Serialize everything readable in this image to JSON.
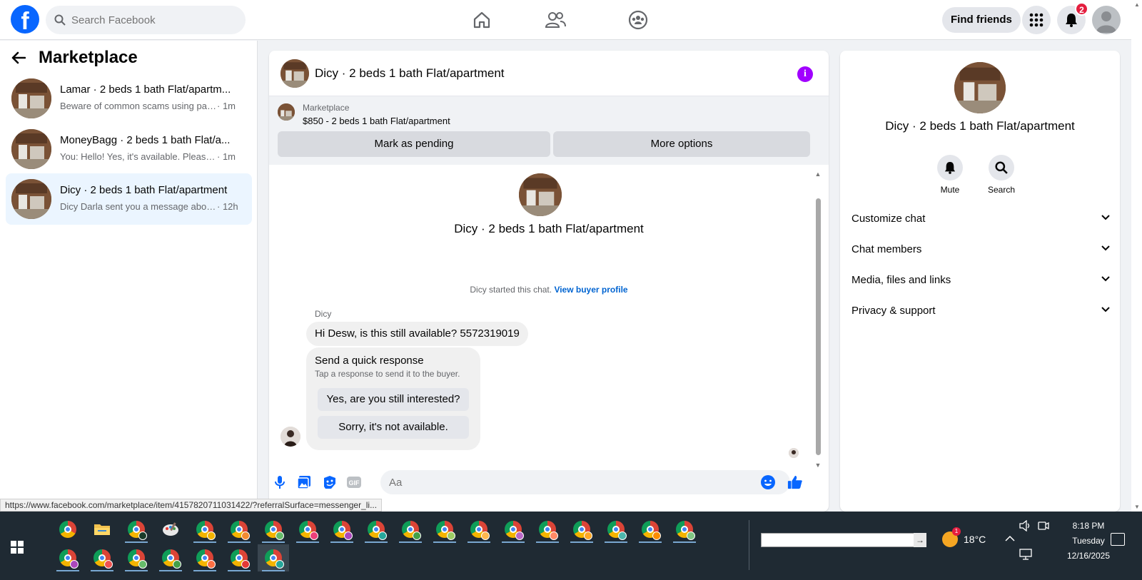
{
  "topbar": {
    "search_placeholder": "Search Facebook",
    "find_friends": "Find friends",
    "notification_count": "2"
  },
  "left": {
    "title": "Marketplace",
    "conversations": [
      {
        "title": "Lamar · 2 beds 1 bath Flat/apartm...",
        "preview": "Beware of common scams using pay...",
        "time": " · 1m",
        "active": false
      },
      {
        "title": "MoneyBagg · 2 beds 1 bath Flat/a...",
        "preview": "You: Hello! Yes, it's available. Please s...",
        "time": " · 1m",
        "active": false
      },
      {
        "title": "Dicy · 2 beds 1 bath Flat/apartment",
        "preview": "Dicy Darla sent you a message about...",
        "time": " · 12h",
        "active": true
      }
    ]
  },
  "chat": {
    "header_title": "Dicy · 2 beds 1 bath Flat/apartment",
    "marketplace_label": "Marketplace",
    "listing": "$850 - 2 beds 1 bath Flat/apartment",
    "mark_pending": "Mark as pending",
    "more_options": "More options",
    "intro_title": "Dicy · 2 beds 1 bath Flat/apartment",
    "started_text": "Dicy started this chat. ",
    "view_buyer_profile": "View buyer profile",
    "sender_name": "Dicy",
    "message": "Hi Desw, is this still available? 5572319019",
    "quick_response_title": "Send a quick response",
    "quick_response_sub": "Tap a response to send it to the buyer.",
    "quick_responses": [
      "Yes, are you still interested?",
      "Sorry, it's not available."
    ],
    "composer_placeholder": "Aa"
  },
  "right": {
    "title": "Dicy · 2 beds 1 bath Flat/apartment",
    "mute": "Mute",
    "search": "Search",
    "sections": [
      "Customize chat",
      "Chat members",
      "Media, files and links",
      "Privacy & support"
    ]
  },
  "status_url": "https://www.facebook.com/marketplace/item/4157820711031422/?referralSurface=messenger_li...",
  "taskbar": {
    "temperature": "18°C",
    "weather_badge": "1",
    "time": "8:18 PM",
    "day": "Tuesday",
    "date": "12/16/2025"
  },
  "colors": {
    "brand": "#0866ff",
    "accent_purple": "#a100ff",
    "active_conversation": "#ebf5ff",
    "badge_red": "#e41e3f"
  }
}
